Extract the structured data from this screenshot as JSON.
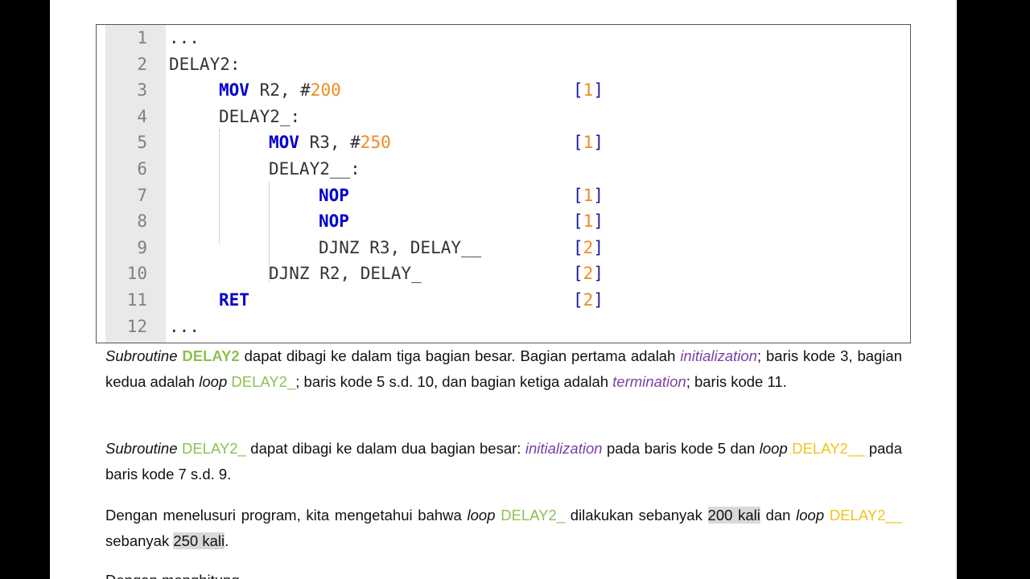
{
  "code": {
    "lines": [
      {
        "n": "1",
        "parts": [
          {
            "t": "..."
          }
        ],
        "cycle": ""
      },
      {
        "n": "2",
        "parts": [
          {
            "t": "DELAY2:"
          }
        ],
        "cycle": ""
      },
      {
        "n": "3",
        "indent": 1,
        "parts": [
          {
            "t": "MOV",
            "c": "kw"
          },
          {
            "t": " R2, #"
          },
          {
            "t": "200",
            "c": "num"
          }
        ],
        "cycle": "1"
      },
      {
        "n": "4",
        "indent": 1,
        "parts": [
          {
            "t": "DELAY2_:"
          }
        ],
        "cycle": ""
      },
      {
        "n": "5",
        "indent": 2,
        "parts": [
          {
            "t": "MOV",
            "c": "kw"
          },
          {
            "t": " R3, #"
          },
          {
            "t": "250",
            "c": "num"
          }
        ],
        "cycle": "1"
      },
      {
        "n": "6",
        "indent": 2,
        "parts": [
          {
            "t": "DELAY2__:"
          }
        ],
        "cycle": ""
      },
      {
        "n": "7",
        "indent": 3,
        "parts": [
          {
            "t": "NOP",
            "c": "kw"
          }
        ],
        "cycle": "1"
      },
      {
        "n": "8",
        "indent": 3,
        "parts": [
          {
            "t": "NOP",
            "c": "kw"
          }
        ],
        "cycle": "1"
      },
      {
        "n": "9",
        "indent": 3,
        "parts": [
          {
            "t": "DJNZ R3, DELAY__"
          }
        ],
        "cycle": "2"
      },
      {
        "n": "10",
        "indent": 2,
        "parts": [
          {
            "t": "DJNZ R2, DELAY_"
          }
        ],
        "cycle": "2"
      },
      {
        "n": "11",
        "indent": 1,
        "parts": [
          {
            "t": "RET",
            "c": "kw"
          }
        ],
        "cycle": "2"
      },
      {
        "n": "12",
        "parts": [
          {
            "t": "..."
          }
        ],
        "cycle": ""
      }
    ]
  },
  "paragraphs": [
    [
      {
        "t": "Subroutine",
        "c": "i"
      },
      {
        "t": " "
      },
      {
        "t": "DELAY2",
        "c": "green-b"
      },
      {
        "t": " dapat dibagi ke dalam tiga bagian besar. Bagian pertama adalah "
      },
      {
        "t": "initialization",
        "c": "purple"
      },
      {
        "t": "; baris kode 3, bagian kedua adalah "
      },
      {
        "t": "loop",
        "c": "i"
      },
      {
        "t": " "
      },
      {
        "t": "DELAY2_",
        "c": "green"
      },
      {
        "t": "; baris kode 5 s.d. 10, dan bagian ketiga adalah "
      },
      {
        "t": "termination",
        "c": "purple"
      },
      {
        "t": "; baris kode 11."
      }
    ],
    [
      {
        "t": "Subroutine",
        "c": "i"
      },
      {
        "t": " "
      },
      {
        "t": "DELAY2_",
        "c": "green"
      },
      {
        "t": " dapat dibagi ke dalam dua bagian besar: "
      },
      {
        "t": "initialization",
        "c": "purple"
      },
      {
        "t": " pada baris kode 5 dan "
      },
      {
        "t": "loop",
        "c": "i"
      },
      {
        "t": " "
      },
      {
        "t": "DELAY2__",
        "c": "yellow"
      },
      {
        "t": " pada baris kode 7 s.d. 9."
      }
    ],
    [
      {
        "t": "Dengan menelusuri program, kita mengetahui bahwa "
      },
      {
        "t": "loop",
        "c": "i"
      },
      {
        "t": " "
      },
      {
        "t": "DELAY2_",
        "c": "green"
      },
      {
        "t": " dilakukan sebanyak "
      },
      {
        "t": "200 kali",
        "c": "hl"
      },
      {
        "t": " dan "
      },
      {
        "t": "loop",
        "c": "i"
      },
      {
        "t": " "
      },
      {
        "t": "DELAY2__",
        "c": "yellow"
      },
      {
        "t": " sebanyak "
      },
      {
        "t": "250 kali",
        "c": "hl"
      },
      {
        "t": "."
      }
    ],
    [
      {
        "t": "Dengan menghitung"
      }
    ]
  ]
}
